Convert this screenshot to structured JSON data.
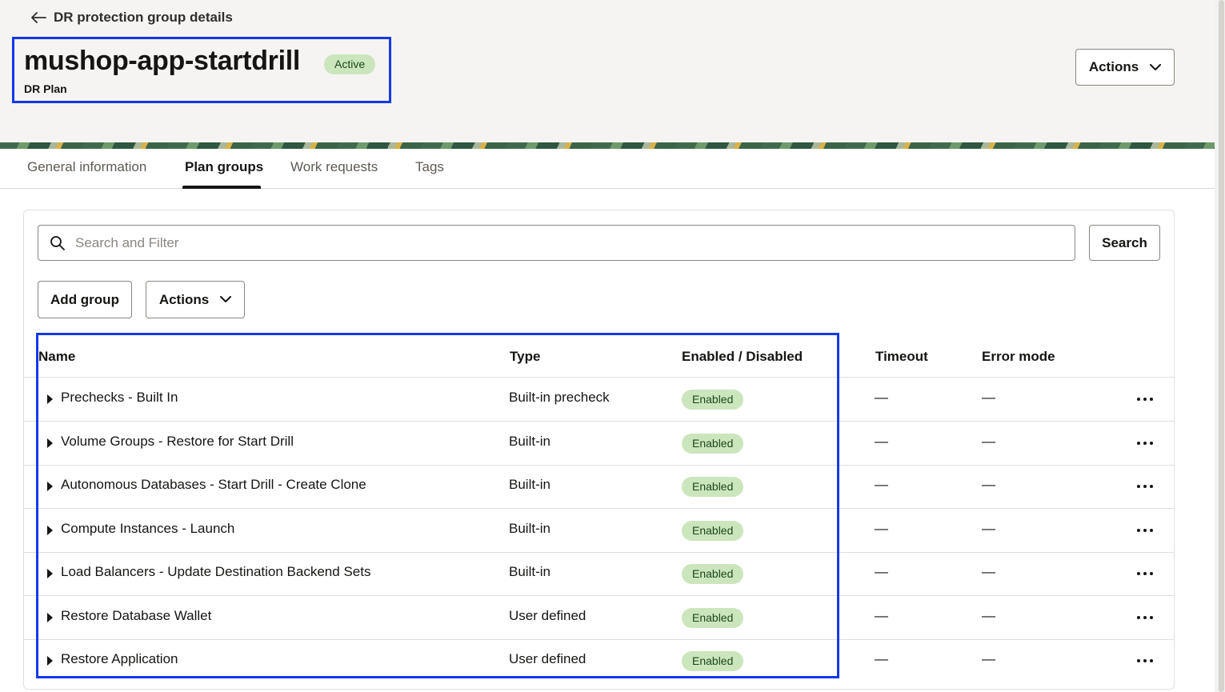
{
  "breadcrumb": {
    "back_label": "DR protection group details"
  },
  "header": {
    "title": "mushop-app-startdrill",
    "status": "Active",
    "subtitle": "DR Plan",
    "actions_label": "Actions"
  },
  "tabs": [
    {
      "label": "General information",
      "active": false
    },
    {
      "label": "Plan groups",
      "active": true
    },
    {
      "label": "Work requests",
      "active": false
    },
    {
      "label": "Tags",
      "active": false
    }
  ],
  "search": {
    "placeholder": "Search and Filter",
    "value": "",
    "button_label": "Search"
  },
  "toolbar": {
    "add_group_label": "Add group",
    "actions_label": "Actions"
  },
  "table": {
    "columns": [
      "Name",
      "Type",
      "Enabled / Disabled",
      "Timeout",
      "Error mode"
    ],
    "rows": [
      {
        "name": "Prechecks - Built In",
        "type": "Built-in precheck",
        "enabled": "Enabled",
        "timeout": "—",
        "error_mode": "—"
      },
      {
        "name": "Volume Groups - Restore for Start Drill",
        "type": "Built-in",
        "enabled": "Enabled",
        "timeout": "—",
        "error_mode": "—"
      },
      {
        "name": "Autonomous Databases - Start Drill - Create Clone",
        "type": "Built-in",
        "enabled": "Enabled",
        "timeout": "—",
        "error_mode": "—"
      },
      {
        "name": "Compute Instances - Launch",
        "type": "Built-in",
        "enabled": "Enabled",
        "timeout": "—",
        "error_mode": "—"
      },
      {
        "name": "Load Balancers - Update Destination Backend Sets",
        "type": "Built-in",
        "enabled": "Enabled",
        "timeout": "—",
        "error_mode": "—"
      },
      {
        "name": "Restore Database Wallet",
        "type": "User defined",
        "enabled": "Enabled",
        "timeout": "—",
        "error_mode": "—"
      },
      {
        "name": "Restore Application",
        "type": "User defined",
        "enabled": "Enabled",
        "timeout": "—",
        "error_mode": "—"
      }
    ]
  },
  "colors": {
    "highlight": "#1339e8",
    "badge_bg": "#cbe6bc",
    "badge_text": "#1e4620",
    "header_bg": "#f5f4f2"
  },
  "icons": [
    "arrow-left-icon",
    "chevron-down-icon",
    "search-icon",
    "caret-right-icon",
    "more-options-icon"
  ]
}
